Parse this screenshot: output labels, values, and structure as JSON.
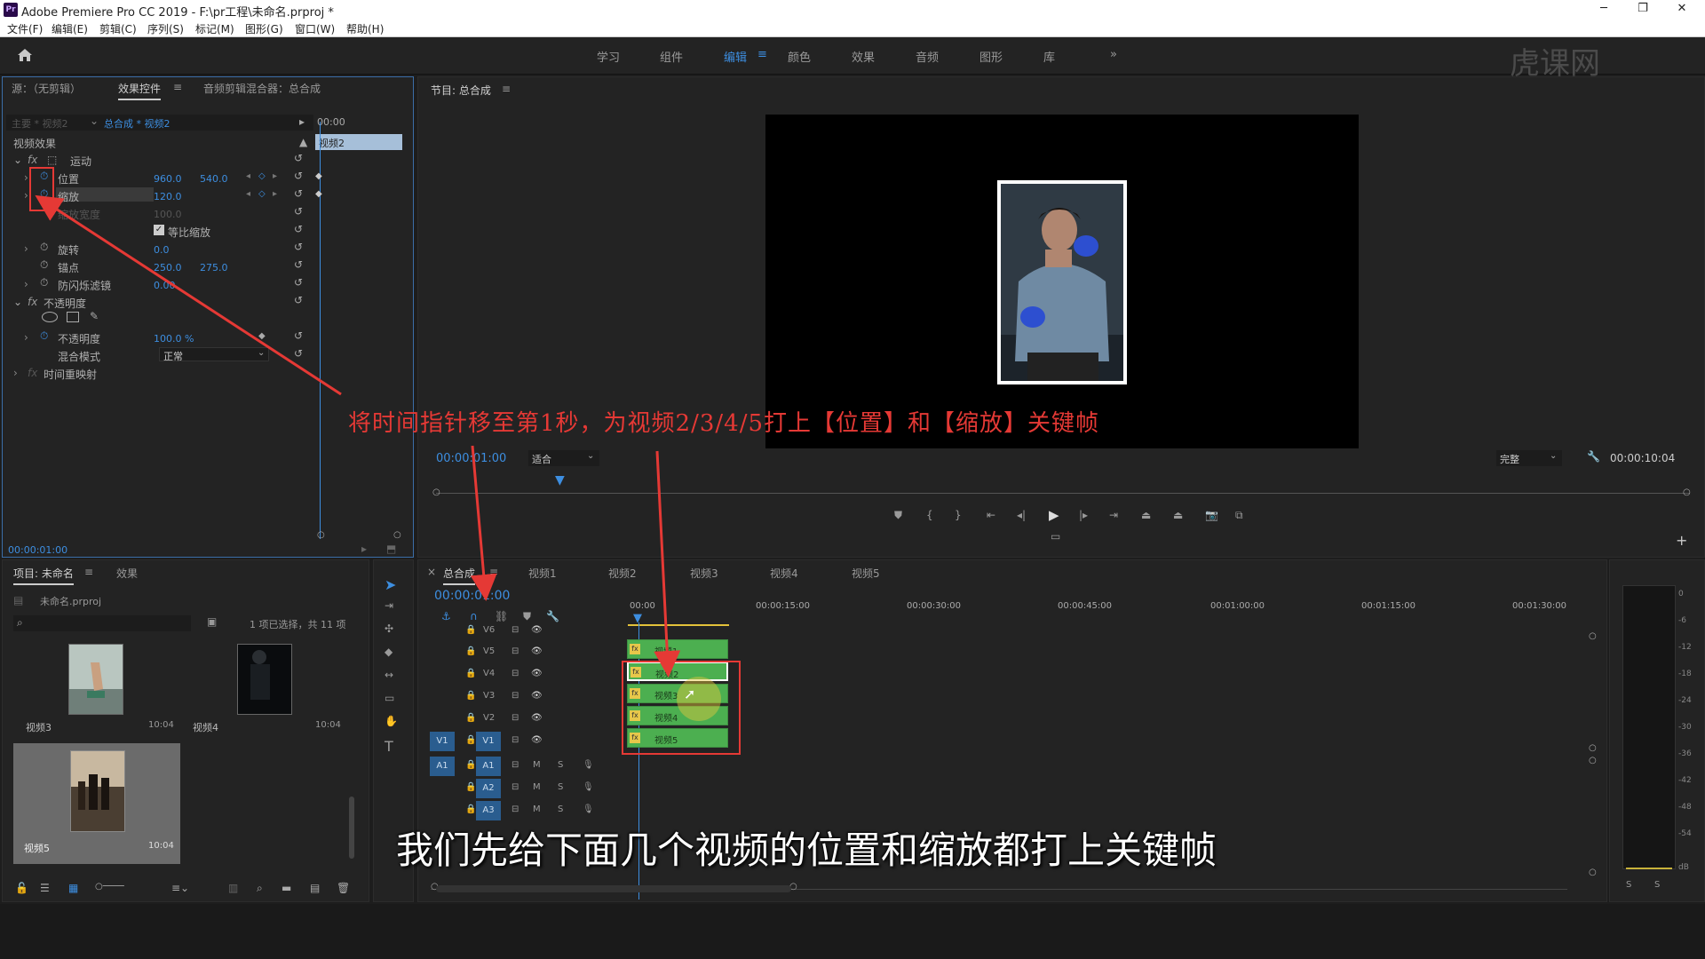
{
  "titlebar": {
    "app_title": "Adobe Premiere Pro CC 2019 - F:\\pr工程\\未命名.prproj *",
    "minimize": "─",
    "restore": "❐",
    "close": "✕"
  },
  "menu": [
    "文件(F)",
    "编辑(E)",
    "剪辑(C)",
    "序列(S)",
    "标记(M)",
    "图形(G)",
    "窗口(W)",
    "帮助(H)"
  ],
  "workspaces": [
    "学习",
    "组件",
    "编辑",
    "颜色",
    "效果",
    "音频",
    "图形",
    "库"
  ],
  "workspace_more": "»",
  "watermark": "虎课网",
  "effect_controls": {
    "tab_source": "源：（无剪辑）",
    "tab_effects": "效果控件",
    "tab_mixer": "音频剪辑混合器：总合成",
    "master": "主要 * 视频2",
    "sequence": "总合成 * 视频2",
    "timecode_mini": "00:00",
    "clip_label": "视频2",
    "section_video": "视频效果",
    "motion": "运动",
    "position_label": "位置",
    "position_x": "960.0",
    "position_y": "540.0",
    "scale_label": "缩放",
    "scale_val": "120.0",
    "scale_width_label": "缩放宽度",
    "scale_width_val": "100.0",
    "uniform_label": "等比缩放",
    "rotation_label": "旋转",
    "rotation_val": "0.0",
    "anchor_label": "锚点",
    "anchor_x": "250.0",
    "anchor_y": "275.0",
    "flicker_label": "防闪烁滤镜",
    "flicker_val": "0.00",
    "opacity_section": "不透明度",
    "opacity_label": "不透明度",
    "opacity_val": "100.0 %",
    "blend_label": "混合模式",
    "blend_val": "正常",
    "time_remap": "时间重映射",
    "bottom_timecode": "00:00:01:00"
  },
  "program": {
    "title": "节目: 总合成",
    "timecode": "00:00:01:00",
    "fit": "适合",
    "quality": "完整",
    "duration": "00:00:10:04"
  },
  "annotation": "将时间指针移至第1秒，为视频2/3/4/5打上【位置】和【缩放】关键帧",
  "subtitle": "我们先给下面几个视频的位置和缩放都打上关键帧",
  "project": {
    "tab": "项目: 未命名",
    "tab_effects": "效果",
    "file": "未命名.prproj",
    "selection": "1 项已选择，共 11 项",
    "items": [
      {
        "name": "视频3",
        "duration": "10:04"
      },
      {
        "name": "视频4",
        "duration": "10:04"
      },
      {
        "name": "视频5",
        "duration": "10:04"
      }
    ]
  },
  "timeline": {
    "tabs": [
      "总合成",
      "视频1",
      "视频2",
      "视频3",
      "视频4",
      "视频5"
    ],
    "timecode": "00:00:01:00",
    "ruler": [
      "00:00",
      "00:00:15:00",
      "00:00:30:00",
      "00:00:45:00",
      "00:01:00:00",
      "00:01:15:00",
      "00:01:30:00"
    ],
    "video_tracks": [
      "V6",
      "V5",
      "V4",
      "V3",
      "V2",
      "V1"
    ],
    "audio_tracks": [
      "A1",
      "A2",
      "A3"
    ],
    "clips": [
      "视频1",
      "视频2",
      "视频3",
      "视频4",
      "视频5"
    ],
    "source_v": "V1",
    "source_a": "A1"
  },
  "meter": {
    "db": [
      "0",
      "-6",
      "-12",
      "-18",
      "-24",
      "-30",
      "-36",
      "-42",
      "-48",
      "-54",
      "dB"
    ],
    "solo": [
      "S",
      "S"
    ]
  },
  "colors": {
    "accent": "#3d8ee0",
    "annotation": "#e53935",
    "clip": "#4caf50"
  }
}
